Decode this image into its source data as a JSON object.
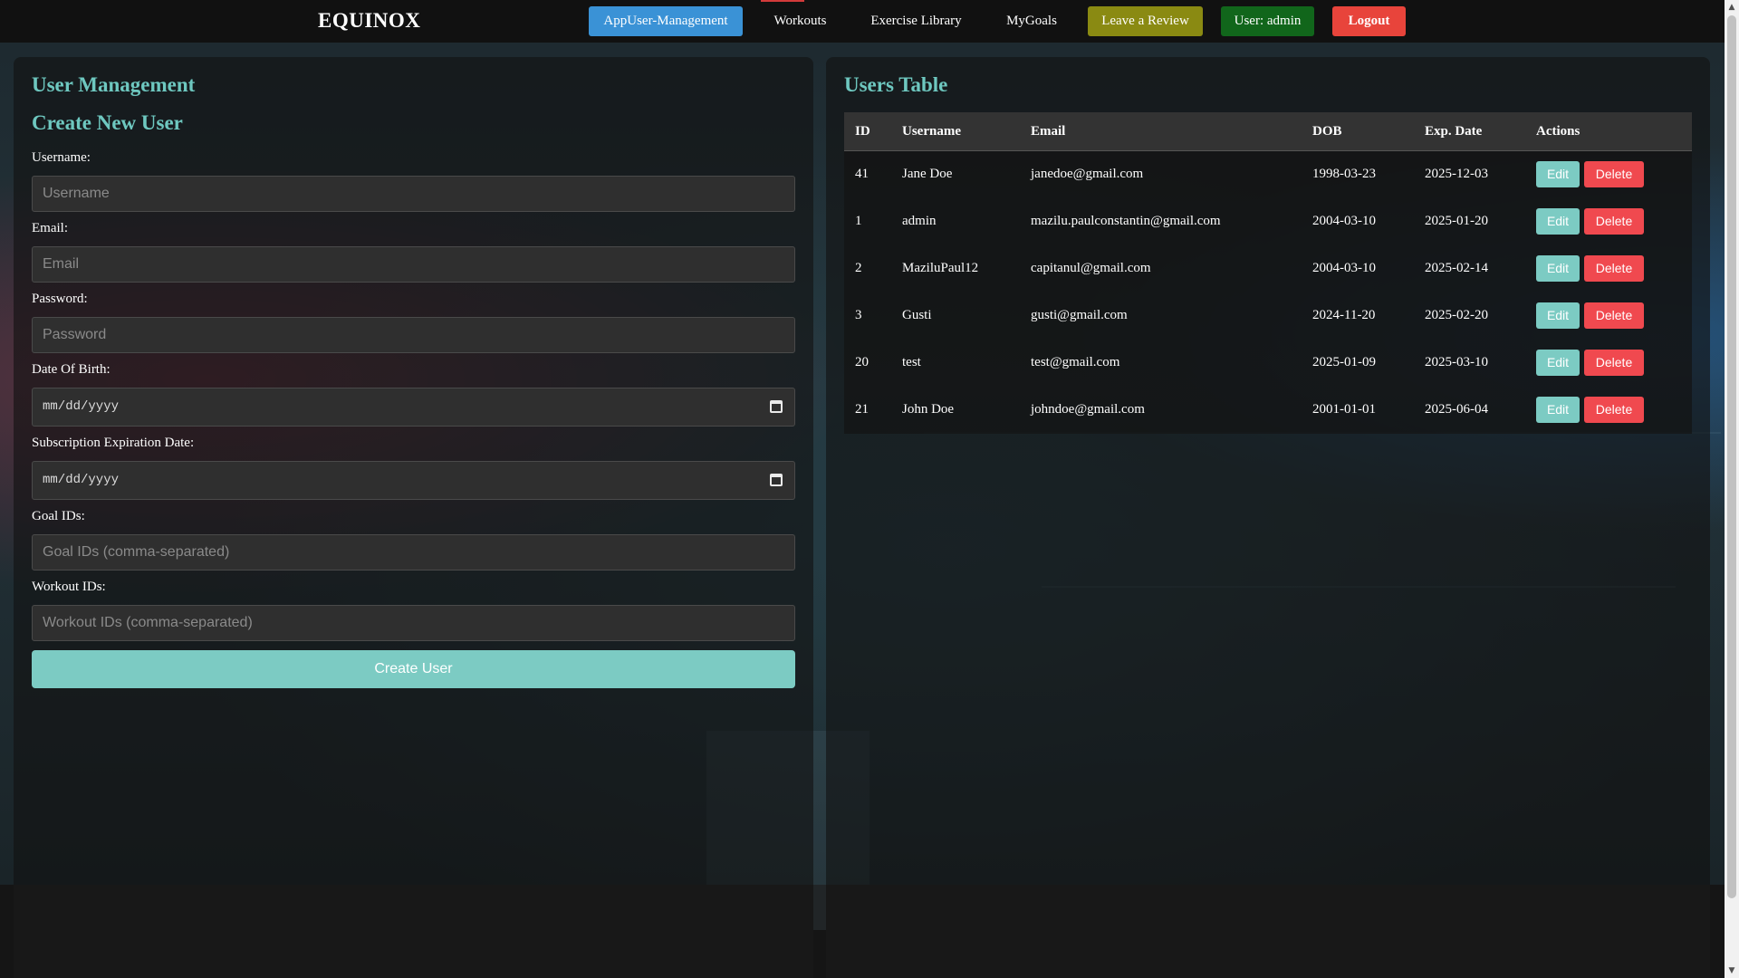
{
  "nav": {
    "brand": "EQUINOX",
    "items": [
      {
        "label": "AppUser-Management"
      },
      {
        "label": "Workouts"
      },
      {
        "label": "Exercise Library"
      },
      {
        "label": "MyGoals"
      },
      {
        "label": "Leave a Review"
      },
      {
        "label": "User: admin"
      },
      {
        "label": "Logout"
      }
    ]
  },
  "left": {
    "title": "User Management",
    "subtitle": "Create New User",
    "fields": [
      {
        "label": "Username:",
        "placeholder": "Username"
      },
      {
        "label": "Email:",
        "placeholder": "Email"
      },
      {
        "label": "Password:",
        "placeholder": "Password"
      },
      {
        "label": "Date Of Birth:",
        "placeholder": "mm/dd/yyyy"
      },
      {
        "label": "Subscription Expiration Date:",
        "placeholder": "mm/dd/yyyy"
      },
      {
        "label": "Goal IDs:",
        "placeholder": "Goal IDs (comma-separated)"
      },
      {
        "label": "Workout IDs:",
        "placeholder": "Workout IDs (comma-separated)"
      }
    ],
    "submit_label": "Create User"
  },
  "right": {
    "title": "Users Table",
    "columns": [
      "ID",
      "Username",
      "Email",
      "DOB",
      "Exp. Date",
      "Actions"
    ],
    "rows": [
      {
        "id": "41",
        "username": "Jane Doe",
        "email": "janedoe@gmail.com",
        "dob": "1998-03-23",
        "exp": "2025-12-03",
        "edit": "Edit",
        "delete": "Delete"
      },
      {
        "id": "1",
        "username": "admin",
        "email": "mazilu.paulconstantin@gmail.com",
        "dob": "2004-03-10",
        "exp": "2025-01-20",
        "edit": "Edit",
        "delete": "Delete"
      },
      {
        "id": "2",
        "username": "MaziluPaul12",
        "email": "capitanul@gmail.com",
        "dob": "2004-03-10",
        "exp": "2025-02-14",
        "edit": "Edit",
        "delete": "Delete"
      },
      {
        "id": "3",
        "username": "Gusti",
        "email": "gusti@gmail.com",
        "dob": "2024-11-20",
        "exp": "2025-02-20",
        "edit": "Edit",
        "delete": "Delete"
      },
      {
        "id": "20",
        "username": "test",
        "email": "test@gmail.com",
        "dob": "2025-01-09",
        "exp": "2025-03-10",
        "edit": "Edit",
        "delete": "Delete"
      },
      {
        "id": "21",
        "username": "John Doe",
        "email": "johndoe@gmail.com",
        "dob": "2001-01-01",
        "exp": "2025-06-04",
        "edit": "Edit",
        "delete": "Delete"
      }
    ]
  },
  "colors": {
    "accent_teal": "#7ccbc3",
    "heading_teal": "#6ec8c0",
    "nav_active_blue": "#3a92d6",
    "review_olive": "#8a8a12",
    "user_green": "#11661b",
    "logout_red": "#e8443b",
    "delete_red": "#f0494f"
  },
  "icons": {
    "calendar": "calendar-icon",
    "scroll_up": "scroll-up-arrow-icon",
    "scroll_down": "scroll-down-arrow-icon"
  }
}
